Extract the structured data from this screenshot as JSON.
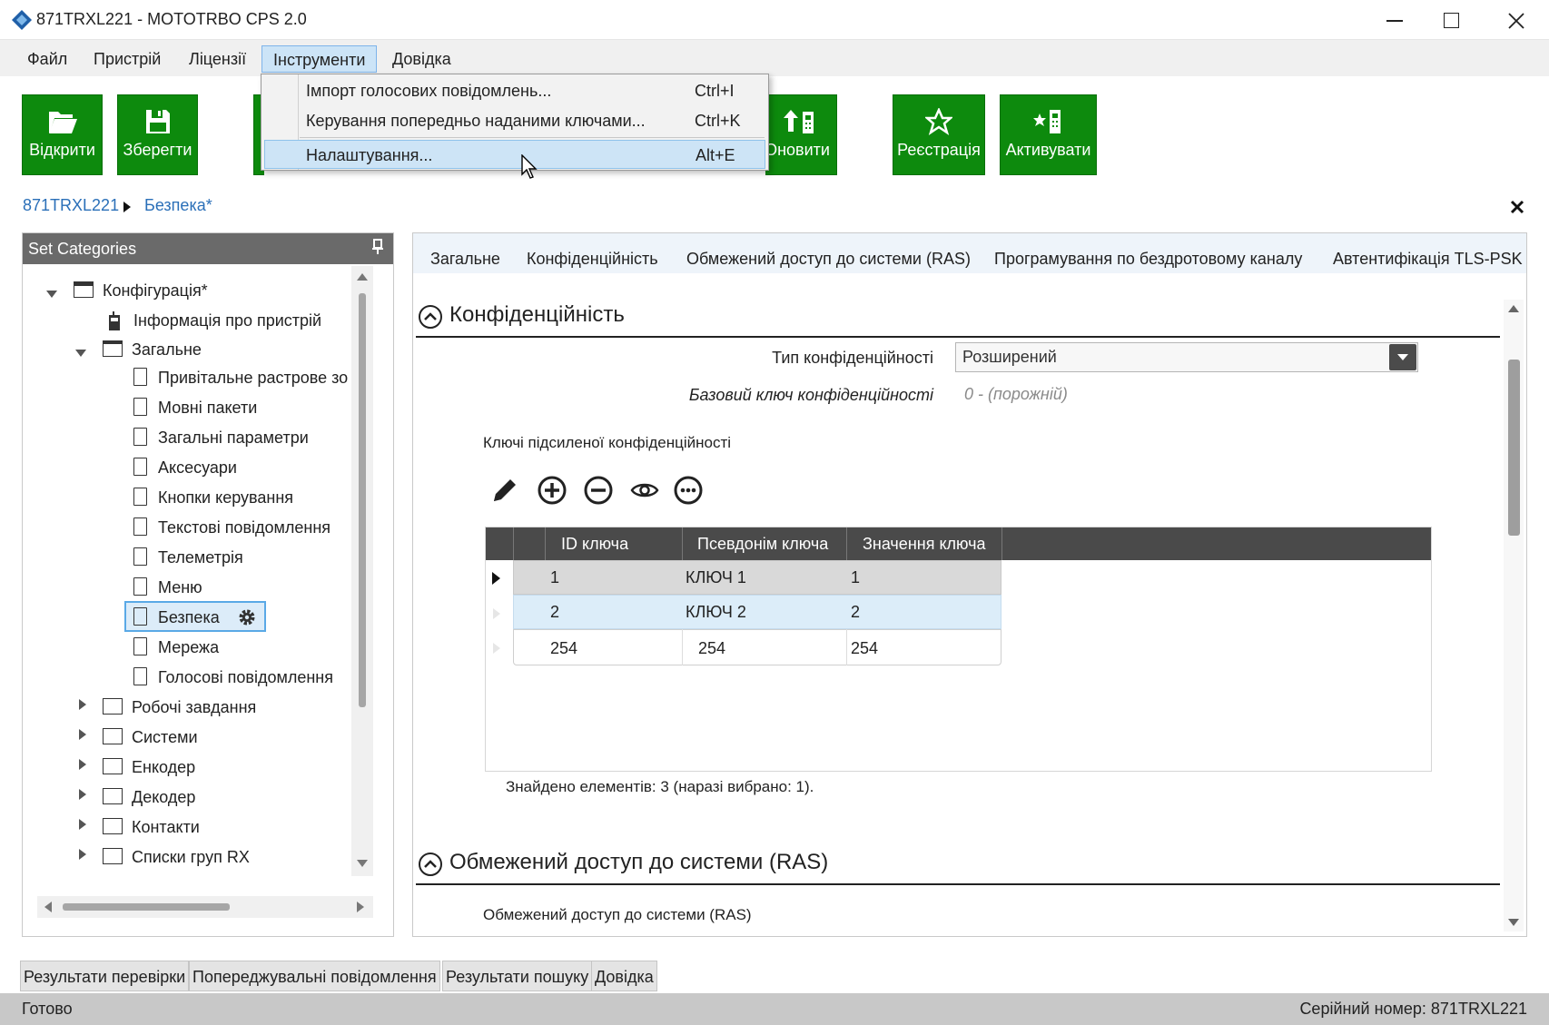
{
  "window": {
    "title": "871TRXL221 - MOTOTRBO CPS 2.0"
  },
  "menubar": {
    "items": [
      "Файл",
      "Пристрій",
      "Ліцензії",
      "Інструменти",
      "Довідка"
    ]
  },
  "toolbar": {
    "open": "Відкрити",
    "save": "Зберегти",
    "update": "Оновити",
    "register": "Реєстрація",
    "activate": "Активувати"
  },
  "dropdown": {
    "items": [
      {
        "label": "Імпорт голосових повідомлень...",
        "shortcut": "Ctrl+I"
      },
      {
        "label": "Керування попередньо наданими ключами...",
        "shortcut": "Ctrl+K"
      },
      {
        "label": "Налаштування...",
        "shortcut": "Alt+E"
      }
    ]
  },
  "breadcrumb": {
    "root": "871TRXL221",
    "current": "Безпека*"
  },
  "sidebar": {
    "title": "Set Categories",
    "items": [
      {
        "label": "Конфігурація*"
      },
      {
        "label": "Інформація про пристрій"
      },
      {
        "label": "Загальне"
      },
      {
        "label": "Привітальне растрове зо"
      },
      {
        "label": "Мовні пакети"
      },
      {
        "label": "Загальні параметри"
      },
      {
        "label": "Аксесуари"
      },
      {
        "label": "Кнопки керування"
      },
      {
        "label": "Текстові повідомлення"
      },
      {
        "label": "Телеметрія"
      },
      {
        "label": "Меню"
      },
      {
        "label": "Безпека"
      },
      {
        "label": "Мережа"
      },
      {
        "label": "Голосові повідомлення"
      },
      {
        "label": "Робочі завдання"
      },
      {
        "label": "Системи"
      },
      {
        "label": "Енкодер"
      },
      {
        "label": "Декодер"
      },
      {
        "label": "Контакти"
      },
      {
        "label": "Списки груп RX"
      }
    ]
  },
  "tabs": [
    "Загальне",
    "Конфіденційність",
    "Обмежений доступ до системи (RAS)",
    "Програмування по бездротовому каналу",
    "Автентифікація TLS-PSK"
  ],
  "privacy": {
    "section_title": "Конфіденційність",
    "type_label": "Тип конфіденційності",
    "type_value": "Розширений",
    "basic_key_label": "Базовий ключ конфіденційності",
    "basic_key_value": "0 - (порожній)",
    "enhanced_keys_label": "Ключі підсиленої конфіденційності",
    "table": {
      "headers": [
        "ID ключа",
        "Псевдонім ключа",
        "Значення ключа"
      ],
      "rows": [
        [
          "1",
          "КЛЮЧ 1",
          "1"
        ],
        [
          "2",
          "КЛЮЧ 2",
          "2"
        ],
        [
          "254",
          "254",
          "254"
        ]
      ]
    },
    "found_text": "Знайдено елементів: 3 (наразі вибрано: 1)."
  },
  "ras": {
    "section_title": "Обмежений доступ до системи (RAS)",
    "field_label": "Обмежений доступ до системи (RAS)"
  },
  "bottom_tabs": [
    "Результати перевірки",
    "Попереджувальні повідомлення",
    "Результати пошуку",
    "Довідка"
  ],
  "status": {
    "left": "Готово",
    "right": "Серійний номер: 871TRXL221"
  },
  "colors": {
    "accent_green": "#0d8a0d",
    "selection_blue": "#cde6f7",
    "header_dark": "#4a4a4a"
  }
}
